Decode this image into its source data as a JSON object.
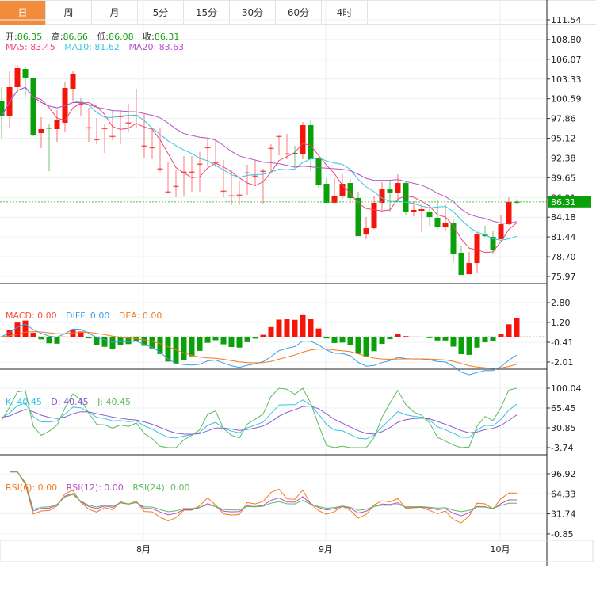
{
  "tabs": [
    "日",
    "周",
    "月",
    "5分",
    "15分",
    "30分",
    "60分",
    "4时"
  ],
  "active_tab": 0,
  "ohlc_legend": {
    "open_label": "开:",
    "open": "86.35",
    "high_label": "高:",
    "high": "86.66",
    "low_label": "低:",
    "low": "86.08",
    "close_label": "收:",
    "close": "86.31"
  },
  "ma_legend": {
    "ma5": "MA5:  83.45",
    "ma10": "MA10:  81.62",
    "ma20": "MA20:  83.63"
  },
  "macd_legend": {
    "macd": "MACD: 0.00",
    "diff": "DIFF: 0.00",
    "dea": "DEA: 0.00"
  },
  "kdj_legend": {
    "k": "K: 40.45",
    "d": "D: 40.45",
    "j": "J: 40.45"
  },
  "rsi_legend": {
    "rsi6": "RSI(6): 0.00",
    "rsi12": "RSI(12): 0.00",
    "rsi24": "RSI(24): 0.00"
  },
  "current_price": "86.31",
  "colors": {
    "up": "#f5140a",
    "down": "#0aa00a",
    "ma5": "#f0447a",
    "ma10": "#35c5e0",
    "ma20": "#b352c8",
    "macd": "#f5503c",
    "diff": "#3b9ce8",
    "dea": "#f57a20",
    "k": "#35c5e0",
    "d": "#8a5ad0",
    "j": "#5cbc5c",
    "rsi6": "#f57a20",
    "rsi12": "#b352c8",
    "rsi24": "#5cbc5c",
    "tab_active": "#f28c3c"
  },
  "chart_data": {
    "type": "candlestick",
    "price_ticks": [
      "111.54",
      "108.80",
      "106.07",
      "103.33",
      "100.59",
      "97.86",
      "95.12",
      "92.38",
      "89.65",
      "86.91",
      "84.18",
      "81.44",
      "78.70",
      "75.97"
    ],
    "price_range": [
      75.97,
      111.54
    ],
    "macd_ticks": [
      "2.80",
      "1.20",
      "-0.41",
      "-2.01"
    ],
    "kdj_ticks": [
      "100.04",
      "65.45",
      "30.85",
      "-3.74"
    ],
    "rsi_ticks": [
      "96.92",
      "64.33",
      "31.74",
      "-0.85"
    ],
    "x_labels": [
      {
        "label": "8月",
        "index": 18
      },
      {
        "label": "9月",
        "index": 41
      },
      {
        "label": "10月",
        "index": 63
      }
    ],
    "ohlc": [
      [
        100.34,
        102.21,
        95.18,
        98.15
      ],
      [
        98.15,
        104.51,
        96.61,
        102.21
      ],
      [
        102.21,
        105.28,
        101.55,
        104.84
      ],
      [
        104.73,
        105.06,
        100.89,
        103.53
      ],
      [
        103.53,
        103.53,
        95.4,
        95.51
      ],
      [
        95.84,
        98.04,
        93.75,
        96.39
      ],
      [
        96.61,
        97.16,
        90.57,
        96.5
      ],
      [
        96.39,
        99.02,
        94.63,
        97.6
      ],
      [
        97.27,
        102.87,
        95.95,
        102.1
      ],
      [
        101.99,
        104.51,
        100.34,
        103.97
      ],
      [
        99.85,
        100.67,
        98.26,
        99.95
      ],
      [
        96.55,
        99.35,
        94.63,
        96.65
      ],
      [
        94.92,
        97.93,
        94.3,
        95.0
      ],
      [
        96.45,
        97.05,
        93.09,
        96.55
      ],
      [
        95.35,
        99.02,
        94.85,
        95.45
      ],
      [
        98.1,
        99.02,
        94.3,
        98.2
      ],
      [
        97.22,
        99.9,
        96.06,
        97.32
      ],
      [
        98.2,
        101.99,
        96.5,
        98.3
      ],
      [
        94.03,
        98.48,
        92.44,
        94.13
      ],
      [
        93.8,
        96.61,
        92.22,
        93.9
      ],
      [
        90.85,
        96.61,
        90.46,
        90.95
      ],
      [
        87.66,
        91.89,
        87.49,
        87.76
      ],
      [
        88.43,
        90.79,
        86.95,
        88.53
      ],
      [
        90.41,
        92.66,
        87.17,
        90.51
      ],
      [
        90.41,
        92.66,
        87.71,
        90.51
      ],
      [
        91.51,
        93.2,
        87.71,
        91.61
      ],
      [
        93.8,
        95.07,
        91.34,
        93.9
      ],
      [
        91.73,
        94.85,
        91.12,
        91.83
      ],
      [
        87.77,
        92.11,
        86.95,
        87.87
      ],
      [
        87.12,
        90.79,
        85.85,
        87.22
      ],
      [
        87.22,
        89.14,
        85.85,
        87.32
      ],
      [
        90.3,
        91.45,
        87.27,
        90.4
      ],
      [
        89.86,
        92.11,
        88.59,
        89.96
      ],
      [
        90.52,
        90.9,
        86.07,
        90.62
      ],
      [
        93.7,
        94.3,
        90.46,
        93.8
      ],
      [
        95.35,
        95.45,
        92.77,
        95.45
      ],
      [
        92.94,
        95.73,
        92.22,
        93.04
      ],
      [
        93.09,
        94.08,
        91.12,
        92.88
      ],
      [
        92.88,
        97.38,
        92.22,
        96.94
      ],
      [
        96.94,
        97.71,
        90.57,
        92.22
      ],
      [
        92.33,
        92.33,
        88.26,
        88.7
      ],
      [
        88.81,
        89.58,
        86.18,
        86.18
      ],
      [
        86.18,
        89.58,
        86.18,
        87.06
      ],
      [
        87.17,
        90.13,
        86.73,
        88.81
      ],
      [
        88.92,
        89.47,
        86.18,
        86.84
      ],
      [
        86.84,
        87.71,
        81.56,
        81.56
      ],
      [
        81.78,
        84.2,
        81.13,
        82.66
      ],
      [
        82.66,
        87.17,
        82.55,
        86.18
      ],
      [
        86.18,
        89.03,
        85.08,
        88.04
      ],
      [
        88.04,
        89.36,
        84.97,
        87.6
      ],
      [
        87.6,
        90.13,
        86.4,
        88.92
      ],
      [
        88.92,
        89.03,
        84.53,
        84.97
      ],
      [
        84.97,
        86.4,
        84.31,
        85.19
      ],
      [
        85.08,
        85.96,
        82.11,
        85.3
      ],
      [
        84.97,
        85.85,
        82.99,
        84.2
      ],
      [
        84.09,
        86.62,
        82.55,
        82.88
      ],
      [
        82.88,
        85.96,
        82.33,
        83.43
      ],
      [
        83.43,
        83.87,
        77.94,
        79.15
      ],
      [
        79.26,
        80.14,
        76.18,
        76.18
      ],
      [
        76.29,
        79.37,
        76.29,
        77.83
      ],
      [
        77.83,
        82.11,
        76.51,
        81.78
      ],
      [
        81.89,
        82.99,
        81.46,
        81.56
      ],
      [
        81.46,
        82.33,
        79.04,
        79.59
      ],
      [
        81.13,
        84.42,
        81.13,
        83.21
      ],
      [
        83.21,
        86.95,
        83.1,
        86.29
      ],
      [
        86.35,
        86.66,
        86.08,
        86.31
      ]
    ]
  }
}
